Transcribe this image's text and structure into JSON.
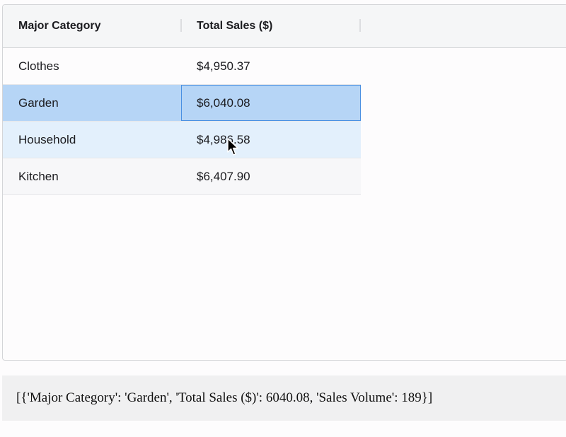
{
  "table": {
    "columns": [
      "Major Category",
      "Total Sales ($)"
    ],
    "rows": [
      {
        "category": "Clothes",
        "sales": "$4,950.37"
      },
      {
        "category": "Garden",
        "sales": "$6,040.08"
      },
      {
        "category": "Household",
        "sales": "$4,986.58"
      },
      {
        "category": "Kitchen",
        "sales": "$6,407.90"
      }
    ],
    "selected_row": 1,
    "hovered_row": 2
  },
  "output": {
    "text": "[{'Major Category': 'Garden', 'Total Sales ($)': 6040.08, 'Sales Volume': 189}]"
  },
  "colors": {
    "selected_row": "#b6d5f6",
    "hover_row": "#e3f0fc",
    "focus_border": "#4a90e2"
  },
  "icons": {
    "cursor": "mouse-pointer-icon"
  }
}
